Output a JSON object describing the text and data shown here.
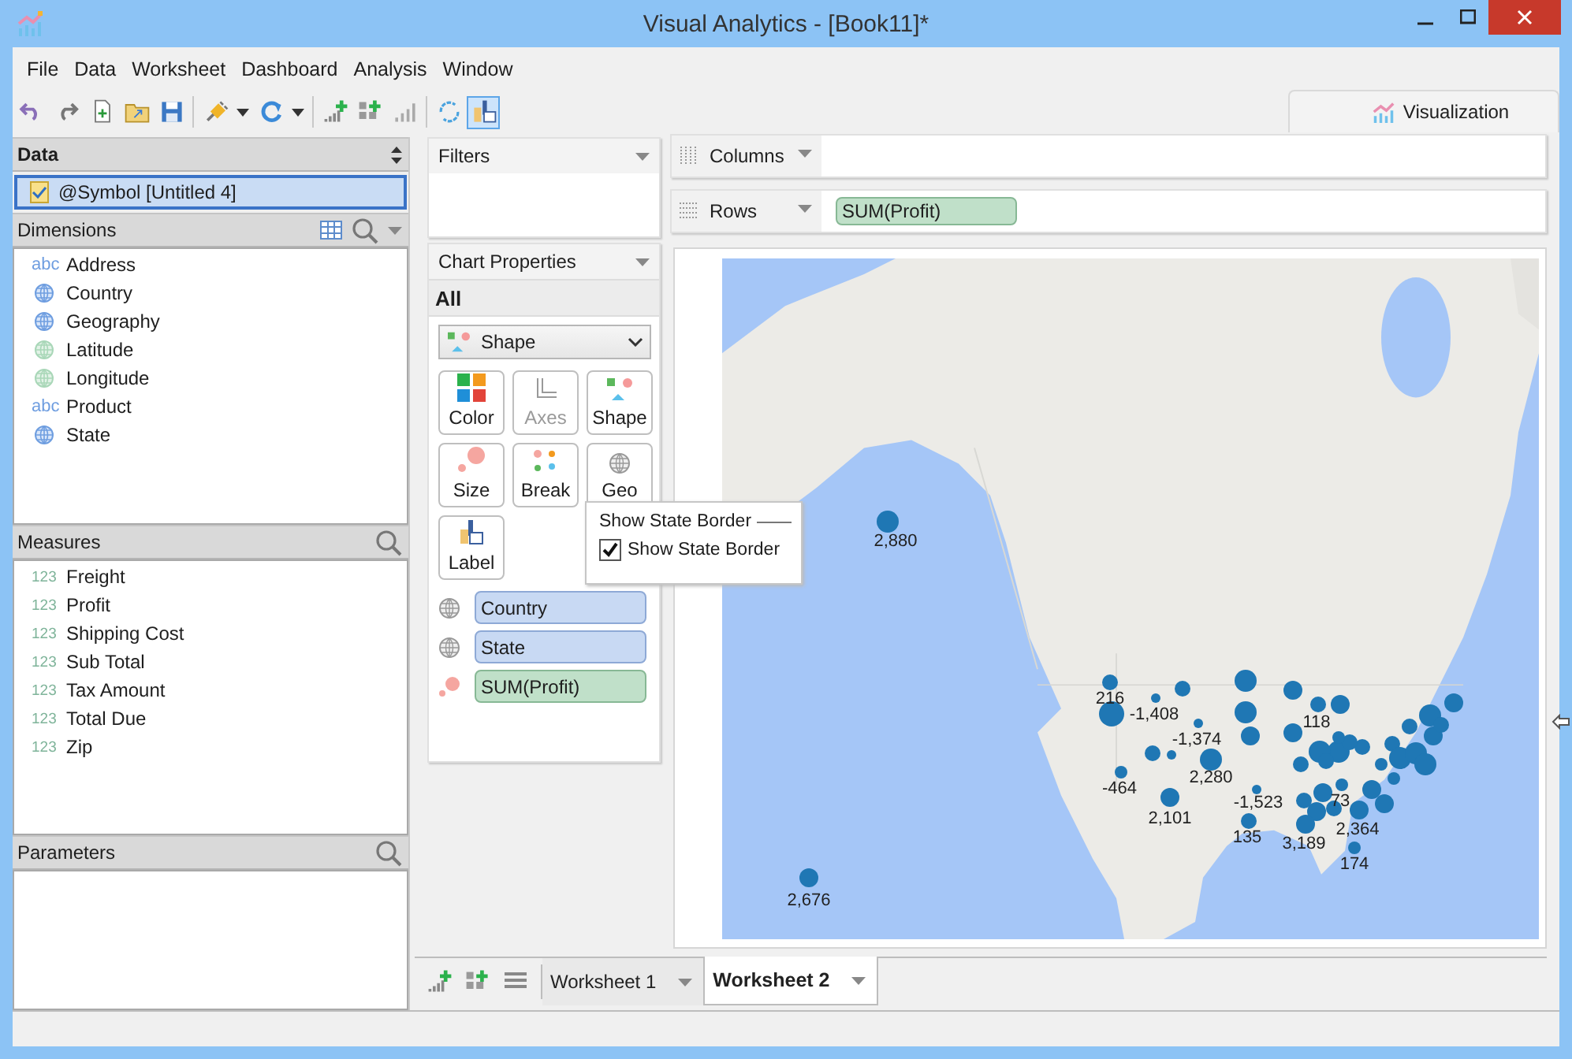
{
  "window": {
    "title": "Visual Analytics - [Book11]*"
  },
  "menu": [
    "File",
    "Data",
    "Worksheet",
    "Dashboard",
    "Analysis",
    "Window"
  ],
  "toolbar": [
    {
      "kind": "undo",
      "selected": false
    },
    {
      "kind": "redo",
      "selected": false
    },
    {
      "kind": "new",
      "selected": false
    },
    {
      "kind": "open",
      "selected": false
    },
    {
      "kind": "save",
      "selected": false
    },
    {
      "kind": "connect",
      "selected": false
    },
    {
      "kind": "caret",
      "selected": false
    },
    {
      "kind": "refresh",
      "selected": false
    },
    {
      "kind": "caret",
      "selected": false
    },
    {
      "kind": "add-chart",
      "selected": false
    },
    {
      "kind": "add-grid",
      "selected": false
    },
    {
      "kind": "bars",
      "selected": false
    },
    {
      "kind": "cycle",
      "selected": false
    },
    {
      "kind": "label-view",
      "selected": true
    }
  ],
  "view_tab": {
    "label": "Visualization"
  },
  "data_panel": {
    "title": "Data",
    "sources": [
      {
        "label": "@Symbol [Untitled 4]",
        "selected": true
      }
    ]
  },
  "dimensions": {
    "title": "Dimensions",
    "items": [
      {
        "kind": "string",
        "tag": "abc",
        "label": "Address"
      },
      {
        "kind": "geo",
        "label": "Country"
      },
      {
        "kind": "geo",
        "label": "Geography"
      },
      {
        "kind": "geo-derived",
        "label": "Latitude"
      },
      {
        "kind": "geo-derived",
        "label": "Longitude"
      },
      {
        "kind": "string",
        "tag": "abc",
        "label": "Product"
      },
      {
        "kind": "geo",
        "label": "State"
      }
    ]
  },
  "measures": {
    "title": "Measures",
    "items": [
      {
        "tag": "123",
        "label": "Freight"
      },
      {
        "tag": "123",
        "label": "Profit"
      },
      {
        "tag": "123",
        "label": "Shipping Cost"
      },
      {
        "tag": "123",
        "label": "Sub Total"
      },
      {
        "tag": "123",
        "label": "Tax Amount"
      },
      {
        "tag": "123",
        "label": "Total Due"
      },
      {
        "tag": "123",
        "label": "Zip"
      }
    ]
  },
  "parameters": {
    "title": "Parameters"
  },
  "filters": {
    "title": "Filters"
  },
  "chart_properties": {
    "title": "Chart Properties",
    "scope": "All",
    "mark_type": "Shape",
    "buttons": [
      {
        "kind": "color",
        "label": "Color",
        "disabled": false
      },
      {
        "kind": "axes",
        "label": "Axes",
        "disabled": true
      },
      {
        "kind": "shape",
        "label": "Shape",
        "disabled": false
      },
      {
        "kind": "size",
        "label": "Size",
        "disabled": false
      },
      {
        "kind": "break",
        "label": "Break",
        "disabled": false
      },
      {
        "kind": "geo",
        "label": "Geo",
        "disabled": false
      },
      {
        "kind": "label",
        "label": "Label",
        "disabled": false
      }
    ],
    "fields": [
      {
        "kind": "dimension",
        "label": "Country"
      },
      {
        "kind": "dimension",
        "label": "State"
      },
      {
        "kind": "measure",
        "label": "SUM(Profit)"
      }
    ]
  },
  "popup": {
    "title": "Show State Border",
    "option": {
      "label": "Show State Border",
      "checked": true
    }
  },
  "shelves": [
    {
      "kind": "columns",
      "label": "Columns"
    },
    {
      "kind": "rows",
      "label": "Rows",
      "pills": [
        "SUM(Profit)"
      ]
    }
  ],
  "map": {
    "kind": "picture",
    "labels": [
      "2,880",
      "216",
      "-1,408",
      "-1,374",
      "118",
      "-464",
      "2,280",
      "2,101",
      "-1,523",
      "135",
      "73",
      "3,189",
      "2,364",
      "174",
      "2,676"
    ]
  },
  "sheet_tabs": [
    {
      "label": "Worksheet 1",
      "selected": false
    },
    {
      "label": "Worksheet 2",
      "selected": true
    }
  ]
}
